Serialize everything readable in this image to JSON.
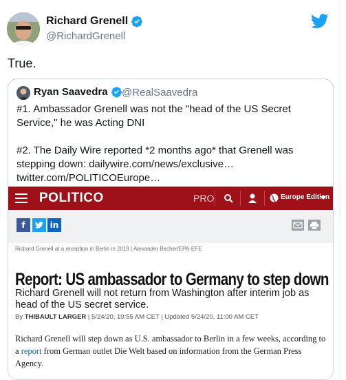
{
  "tweet": {
    "author_name": "Richard Grenell",
    "author_handle": "@RichardGrenell",
    "text": "True."
  },
  "quoted": {
    "author_name": "Ryan Saavedra",
    "author_handle": "@RealSaavedra",
    "line1": "#1. Ambassador Grenell was not the \"head of the US Secret Service,\" he was Acting DNI",
    "line2": "#2. The Daily Wire reported *2 months ago* that Grenell was stepping down: dailywire.com/news/exclusive… twitter.com/POLITICOEurope…"
  },
  "article": {
    "logo": "POLITICO",
    "pro_label": "PRO",
    "edition_label": "Europe Edition",
    "share_fb": "f",
    "share_in": "in",
    "photo_caption": "Richard Grenell at a reception in Berlin in 2019 | Alexander Becher/EPA-EFE",
    "headline": "Report: US ambassador to Germany to step down",
    "subhead": "Richard Grenell will not return from Washington after interim job as head of the US secret service.",
    "byline_prefix": "By ",
    "byline_author": "THIBAULT LARGER",
    "byline_dates": " | 5/24/20, 10:55 AM CET | Updated 5/24/20, 11:00 AM CET",
    "body_part1": "Richard Grenell will step down as U.S. ambassador to Berlin in a few weeks, according to a ",
    "body_link": "report",
    "body_part2": " from German outlet Die Welt based on information from the German Press Agency."
  },
  "colors": {
    "politico_red": "#9e1118",
    "twitter_blue": "#1da1f2",
    "link_blue": "#1a5fa6"
  }
}
